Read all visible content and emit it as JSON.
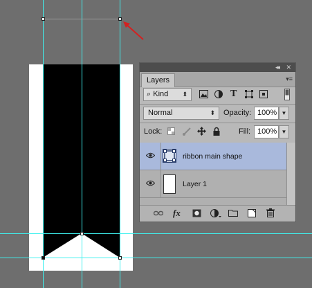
{
  "panel": {
    "tab_label": "Layers",
    "collapse_glyph": "◂◂",
    "close_glyph": "✕",
    "menu_glyph": "▾≡",
    "filter": {
      "value": "Kind",
      "search_glyph": "⌕",
      "arrow": "⬍"
    },
    "blend_mode": {
      "value": "Normal",
      "arrow": "⬍"
    },
    "opacity": {
      "label": "Opacity:",
      "value": "100%",
      "arrow": "▼"
    },
    "lock": {
      "label": "Lock:"
    },
    "fill": {
      "label": "Fill:",
      "value": "100%",
      "arrow": "▼"
    },
    "layers": [
      {
        "name": "ribbon main shape",
        "selected": true,
        "kind": "shape"
      },
      {
        "name": "Layer 1",
        "selected": false,
        "kind": "pixel"
      }
    ],
    "bottom_icons": [
      "link-icon",
      "fx-icon",
      "mask-icon",
      "adjustment-icon",
      "group-folder-icon",
      "new-layer-icon",
      "trash-icon"
    ],
    "fx_label": "fx"
  },
  "colors": {
    "canvas_bg": "#6e6e6e",
    "guide": "#3ff0ee",
    "ribbon": "#000000",
    "selected_layer": "#a9b9dc",
    "annotation_arrow": "#d42020"
  }
}
